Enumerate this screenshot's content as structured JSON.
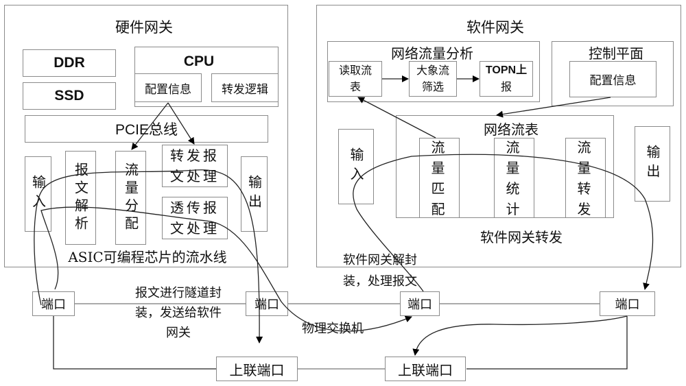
{
  "hardware_gateway": {
    "title": "硬件网关",
    "ddr": "DDR",
    "ssd": "SSD",
    "cpu": {
      "title": "CPU",
      "config_info": "配置信息",
      "forward_logic": "转发逻辑"
    },
    "pcie_bus": "PCIE总线",
    "input": "输入",
    "packet_parse": "报文解析",
    "flow_distribute": "流量分配",
    "forward_process_line1": "转发报",
    "forward_process_line2": "文处理",
    "passthrough_line1": "透传报",
    "passthrough_line2": "文处理",
    "output": "输出",
    "pipeline_label": "ASIC可编程芯片的流水线"
  },
  "software_gateway": {
    "title": "软件网关",
    "traffic_analysis": {
      "title": "网络流量分析",
      "read_flow_table_line1": "读取流",
      "read_flow_table_line2": "表",
      "elephant_filter_line1": "大象流",
      "elephant_filter_line2": "筛选",
      "topn_line1": "TOPN上",
      "topn_line2": "报"
    },
    "control_plane": {
      "title": "控制平面",
      "config_info": "配置信息"
    },
    "flow_table": {
      "title": "网络流表",
      "match": "流量匹配",
      "stats": "流量统计",
      "forward": "流量转发"
    },
    "input": "输入",
    "output": "输出",
    "forward_label": "软件网关转发"
  },
  "network": {
    "port_label": "端口",
    "uplink_port_label": "上联端口",
    "physical_switch": "物理交换机",
    "encap_note_line1": "报文进行隧道封",
    "encap_note_line2": "装，发送给软件",
    "encap_note_line3": "网关",
    "decap_note_line1": "软件网关解封",
    "decap_note_line2": "装，处理报文"
  }
}
